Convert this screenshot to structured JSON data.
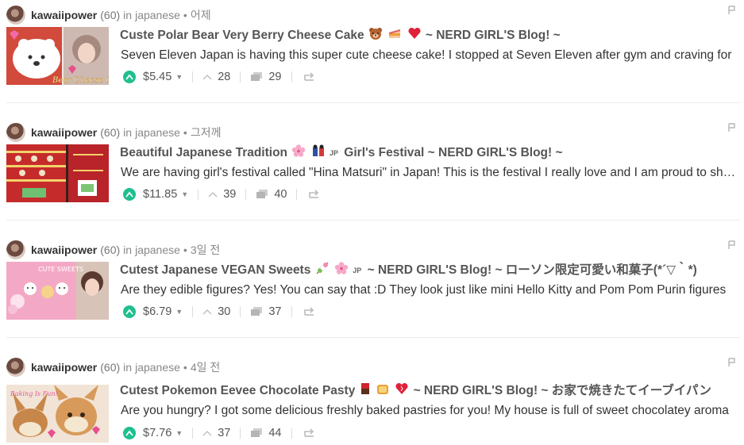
{
  "colors": {
    "upvote": "#1fbf8f",
    "muted": "#888888",
    "title": "#555555"
  },
  "posts": [
    {
      "author": "kawaiipower",
      "rep": "(60)",
      "in_word": "in",
      "category": "japanese",
      "time": "어제",
      "title_main": "Custe Polar Bear Very Berry Cheese Cake",
      "title_tail": "~ NERD GIRL'S Blog! ~",
      "title_jp": "",
      "emoji_names": [
        "bear-face-icon",
        "cake-icon",
        "heart-icon"
      ],
      "excerpt": "Seven Eleven Japan is having this super cute cheese cake! I stopped at Seven Eleven after gym and craving for",
      "payout": "$5.45",
      "votes": "28",
      "comments": "29",
      "thumb_text": "Bear Cheese Cake!"
    },
    {
      "author": "kawaiipower",
      "rep": "(60)",
      "in_word": "in",
      "category": "japanese",
      "time": "그저께",
      "title_main": "Beautiful Japanese Tradition",
      "title_tail": "Girl's Festival ~ NERD GIRL'S Blog! ~",
      "title_jp": "JP",
      "emoji_names": [
        "cherry-blossom-icon",
        "dolls-icon"
      ],
      "excerpt": "We are having girl's festival called \"Hina Matsuri\" in Japan! This is the festival I really love and I am proud to share",
      "payout": "$11.85",
      "votes": "39",
      "comments": "40",
      "thumb_text": ""
    },
    {
      "author": "kawaiipower",
      "rep": "(60)",
      "in_word": "in",
      "category": "japanese",
      "time": "3일 전",
      "title_main": "Cutest Japanese VEGAN Sweets",
      "title_tail": "~ NERD GIRL'S Blog! ~ ローソン限定可愛い和菓子(*´▽｀*)",
      "title_jp": "JP",
      "emoji_names": [
        "dango-icon",
        "cherry-blossom-icon"
      ],
      "excerpt": "Are they edible figures? Yes! You can say that :D They look just like mini Hello Kitty and Pom Pom Purin figures",
      "payout": "$6.79",
      "votes": "30",
      "comments": "37",
      "thumb_text": "CUTE SWEETS"
    },
    {
      "author": "kawaiipower",
      "rep": "(60)",
      "in_word": "in",
      "category": "japanese",
      "time": "4일 전",
      "title_main": "Cutest Pokemon Eevee Chocolate Pasty",
      "title_tail": "~ NERD GIRL'S Blog! ~ お家で焼きたてイーブイパン",
      "title_jp": "",
      "emoji_names": [
        "chocolate-icon",
        "bread-icon",
        "heart-icon"
      ],
      "excerpt": "Are you hungry? I got some delicious freshly baked pastries for you! My house is full of sweet chocolatey aroma",
      "payout": "$7.76",
      "votes": "37",
      "comments": "44",
      "thumb_text": "Baking Is Fun!"
    }
  ]
}
